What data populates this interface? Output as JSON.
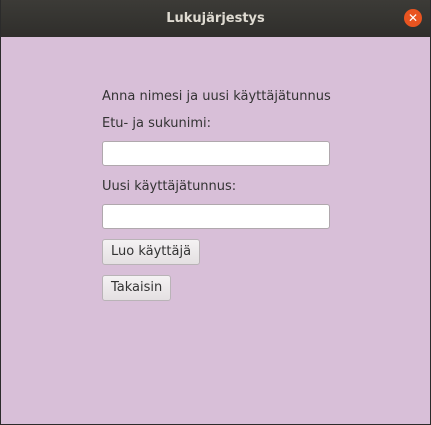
{
  "window": {
    "title": "Lukujärjestys",
    "close_glyph": "✕"
  },
  "form": {
    "intro": "Anna nimesi ja uusi käyttäjätunnus",
    "name_label": "Etu- ja sukunimi:",
    "name_value": "",
    "username_label": "Uusi käyttäjätunnus:",
    "username_value": "",
    "create_button": "Luo käyttäjä",
    "back_button": "Takaisin"
  },
  "colors": {
    "background": "#d8bfd8",
    "titlebar": "#2f2e2b",
    "close_button": "#e95420"
  }
}
